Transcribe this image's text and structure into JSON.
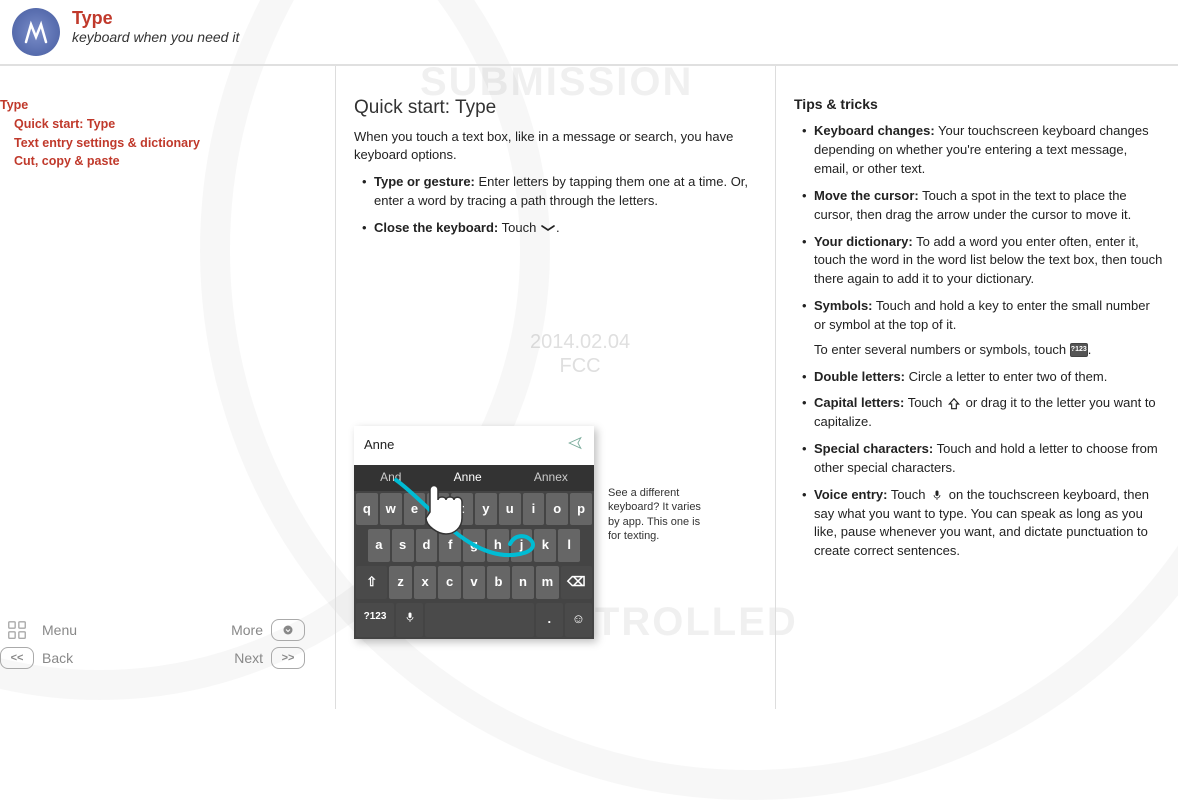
{
  "header": {
    "title": "Type",
    "subtitle": "keyboard when you need it"
  },
  "sidebar": {
    "heading": "Type",
    "items": [
      "Quick start: Type",
      "Text entry settings & dictionary",
      "Cut, copy & paste"
    ],
    "footer": {
      "menu": "Menu",
      "more": "More",
      "back": "Back",
      "next": "Next"
    }
  },
  "watermark": {
    "submission": "SUBMISSION",
    "controlled": "CONTROLLED",
    "date": "2014.02.04",
    "fcc": "FCC"
  },
  "col1": {
    "heading": "Quick start: Type",
    "intro": "When you touch a text box, like in a message or search, you have keyboard options.",
    "b1_title": "Type or gesture:",
    "b1_text": " Enter letters by tapping them one at a time. Or, enter a word by tracing a path through the letters.",
    "b2_title": "Close the keyboard:",
    "b2_text": " Touch ",
    "kb": {
      "input_value": "Anne",
      "sugg1": "And",
      "sugg2": "Anne",
      "sugg3": "Annex",
      "row1": [
        "q",
        "w",
        "e",
        "r",
        "t",
        "y",
        "u",
        "i",
        "o",
        "p"
      ],
      "row2": [
        "a",
        "s",
        "d",
        "f",
        "g",
        "h",
        "j",
        "k",
        "l"
      ],
      "row3_shift": "⇧",
      "row3": [
        "z",
        "x",
        "c",
        "v",
        "b",
        "n",
        "m"
      ],
      "row3_del": "⌫",
      "row4_sym": "?123",
      "row4_mic": "🎤",
      "row4_dot": ".",
      "row4_emoji": "☺"
    },
    "caption": "See a different keyboard? It varies by app. This one is for texting."
  },
  "col2": {
    "heading": "Tips & tricks",
    "t1_title": "Keyboard changes:",
    "t1_text": " Your touchscreen keyboard changes depending on whether you're entering a text message, email, or other text.",
    "t2_title": "Move the cursor:",
    "t2_text": " Touch a spot in the text to place the cursor, then drag the arrow under the cursor to move it.",
    "t3_title": "Your dictionary:",
    "t3_text": " To add a word you enter often, enter it, touch the word in the word list below the text box, then touch there again to add it to your dictionary.",
    "t4_title": "Symbols:",
    "t4_text": " Touch and hold a key to enter the small number or symbol at the top of it.",
    "t4_extra_pre": "To enter several numbers or symbols, touch ",
    "t4_extra_post": ".",
    "t4_key_label": "?123",
    "t5_title": "Double letters:",
    "t5_text": " Circle a letter to enter two of them.",
    "t6_title": "Capital letters:",
    "t6_text_pre": " Touch ",
    "t6_text_post": " or drag it to the letter you want to capitalize.",
    "t7_title": "Special characters:",
    "t7_text": " Touch and hold a letter to choose from other special characters.",
    "t8_title": "Voice entry:",
    "t8_text_pre": " Touch ",
    "t8_text_post": " on the touchscreen keyboard, then say what you want to type. You can speak as long as you like, pause whenever you want, and dictate punctuation to create correct sentences."
  }
}
